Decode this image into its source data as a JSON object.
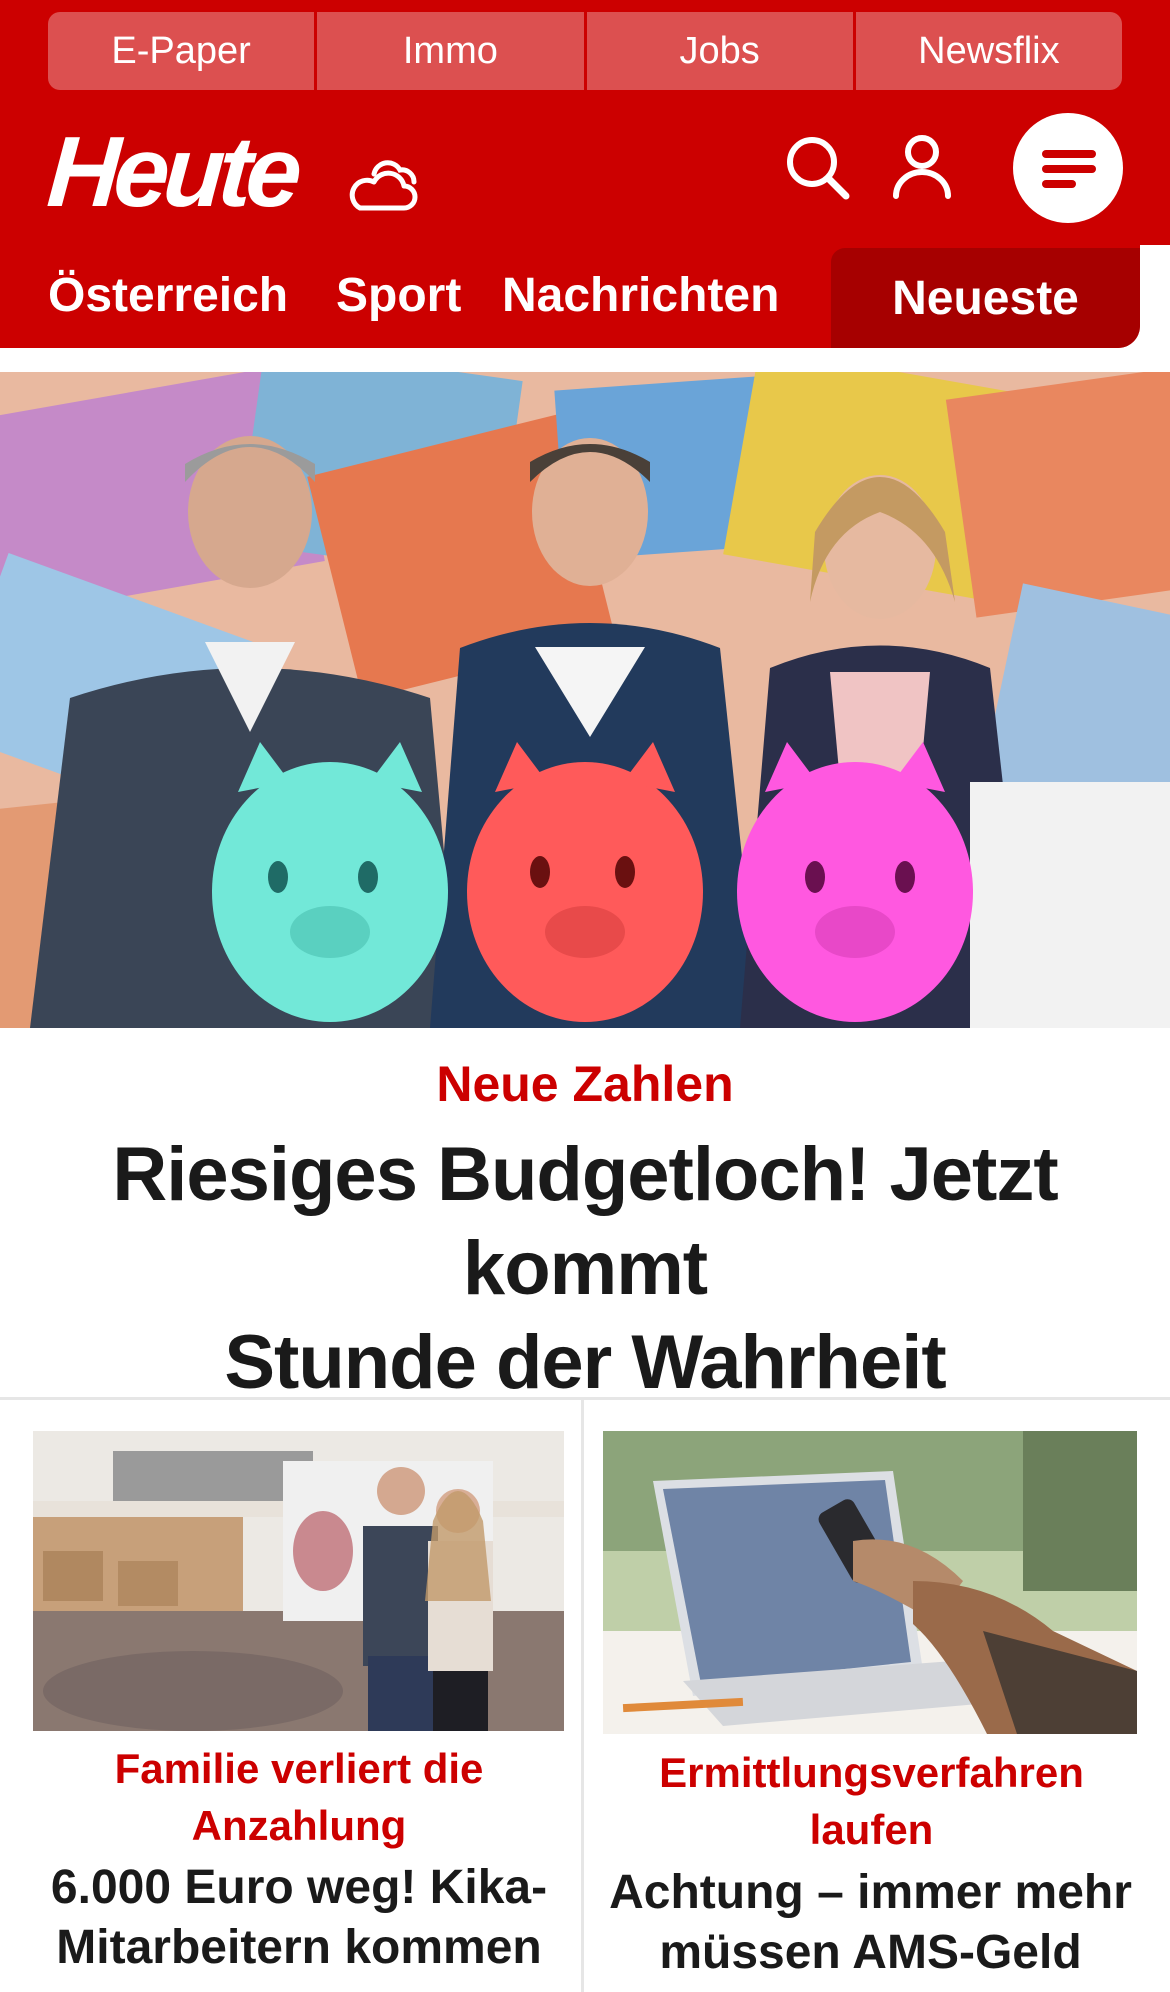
{
  "header": {
    "services": [
      "E-Paper",
      "Immo",
      "Jobs",
      "Newsflix"
    ],
    "logo_text": "Heute",
    "icons": {
      "weather": "weather-cloud-icon",
      "search": "search-icon",
      "account": "user-icon",
      "menu": "menu-icon"
    },
    "sections": [
      "Österreich",
      "Sport",
      "Nachrichten"
    ],
    "active_section": "Neueste"
  },
  "lead": {
    "kicker": "Neue Zahlen",
    "headline_line1": "Riesiges Budgetloch! Jetzt kommt",
    "headline_line2": "Stunde der Wahrheit"
  },
  "teasers": [
    {
      "kicker_line1": "Familie verliert die",
      "kicker_line2": "Anzahlung",
      "title_line1": "6.000 Euro weg! Kika-",
      "title_line2": "Mitarbeitern kommen"
    },
    {
      "kicker_line1": "Ermittlungsverfahren",
      "kicker_line2": "laufen",
      "title_line1": "Achtung – immer mehr",
      "title_line2": "müssen AMS-Geld"
    }
  ],
  "colors": {
    "brand_red": "#cc0000",
    "active_tab_red": "#a60000",
    "service_tab_red": "#dc5050",
    "headline_text": "#1a1a1a"
  }
}
